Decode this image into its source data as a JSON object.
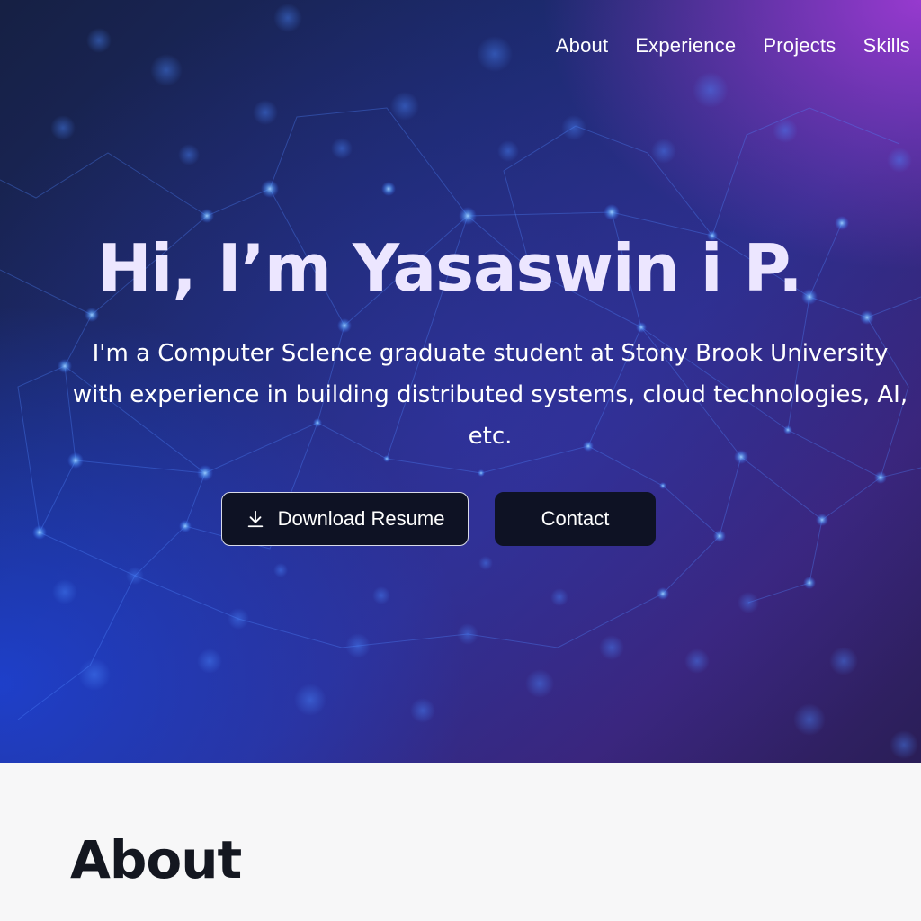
{
  "nav": {
    "items": [
      {
        "label": "About"
      },
      {
        "label": "Experience"
      },
      {
        "label": "Projects"
      },
      {
        "label": "Skills"
      }
    ]
  },
  "hero": {
    "title": "Hi, I’m Yasaswin i P.",
    "subtitle": "I'm a Computer Sclence graduate student at Stony Brook University with experience in building distributed systems, cloud technologies, AI, etc.",
    "buttons": {
      "resume_label": "Download Resume",
      "resume_icon": "download-icon",
      "contact_label": "Contact"
    }
  },
  "about": {
    "heading": "About"
  },
  "colors": {
    "hero_bg_dark": "#162043",
    "hero_accent_purple": "#aa3cdc",
    "hero_accent_blue": "#1e46e6",
    "title_color": "#ece6ff",
    "button_bg": "#0e1224",
    "section_bg": "#f7f7f8",
    "heading_color": "#141720"
  }
}
